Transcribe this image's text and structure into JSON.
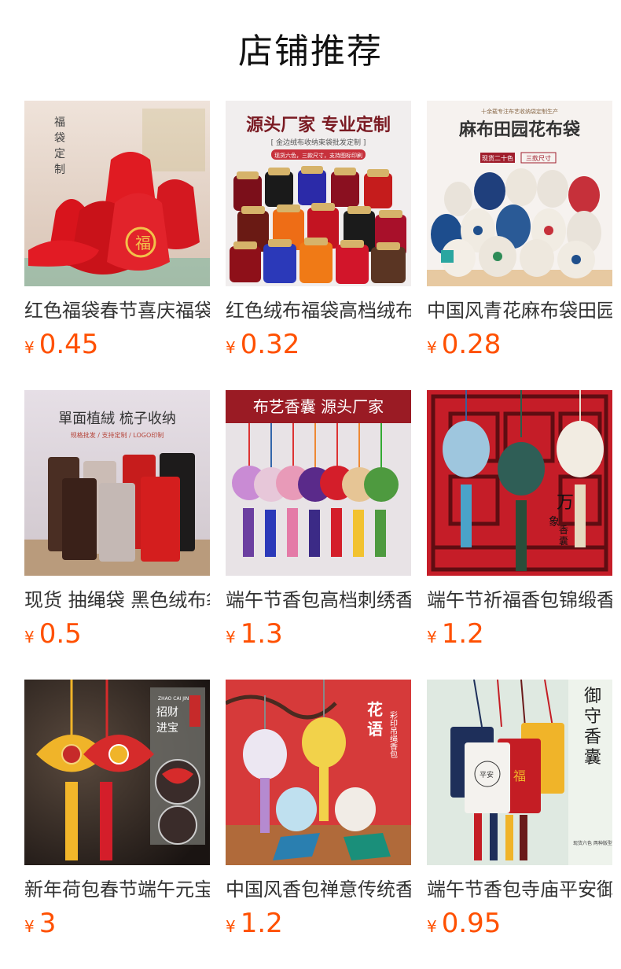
{
  "header": {
    "title": "店铺推荐"
  },
  "currency": "¥",
  "products": [
    {
      "name": "红色福袋春节喜庆福袋",
      "price": "0.45",
      "thumb_texts": [
        "福",
        "袋",
        "定",
        "制",
        "福"
      ],
      "colors": {
        "bg": "#e9d8cc",
        "main": "#d8141c",
        "accent": "#f3c14a"
      }
    },
    {
      "name": "红色绒布福袋高档绒布袋",
      "price": "0.32",
      "thumb_texts": [
        "源头厂家 专业定制",
        "[ 金边绒布收纳束袋批发定制 ]",
        "现货六色，三款尺寸，支持图标印刷"
      ],
      "colors": {
        "bg": "#f1eeee",
        "main": "#9b0f1e",
        "accent": "#d6b36a"
      }
    },
    {
      "name": "中国风青花麻布袋田园风",
      "price": "0.28",
      "thumb_texts": [
        "十余载专注布艺收纳袋定制生产",
        "麻布田园花布袋",
        "现货二十色",
        "三款尺寸"
      ],
      "colors": {
        "bg": "#f6f2ef",
        "main": "#e9e3da",
        "accent": "#1f4f8c"
      }
    },
    {
      "name": "现货 抽绳袋 黑色绒布袋",
      "price": "0.5",
      "thumb_texts": [
        "單面植絨 梳子收纳",
        "规格批发 / 支持定制 / LOGO印制"
      ],
      "colors": {
        "bg": "#d9d2d6",
        "main": "#4a2e23",
        "accent": "#c61c1c"
      }
    },
    {
      "name": "端午节香包高档刺绣香囊",
      "price": "1.3",
      "thumb_texts": [
        "布艺香囊 源头厂家"
      ],
      "colors": {
        "bg": "#e8e3e6",
        "main": "#9a1b24",
        "accent": "#6b3fa0"
      }
    },
    {
      "name": "端午节祈福香包锦缎香囊",
      "price": "1.2",
      "thumb_texts": [
        "万",
        "象",
        "香",
        "囊"
      ],
      "colors": {
        "bg": "#c51d28",
        "main": "#5f0d12",
        "accent": "#4aa3c9"
      }
    },
    {
      "name": "新年荷包春节端午元宝香包",
      "price": "3",
      "thumb_texts": [
        "招财",
        "进宝",
        "ZHAO CAI JIN BAO"
      ],
      "colors": {
        "bg": "#2a2220",
        "main": "#d62b2b",
        "accent": "#f0b429"
      }
    },
    {
      "name": "中国风香包禅意传统香囊",
      "price": "1.2",
      "thumb_texts": [
        "花",
        "语",
        "彩印吊绳香包"
      ],
      "colors": {
        "bg": "#d63a3a",
        "main": "#f2d24a",
        "accent": "#7b55b0"
      }
    },
    {
      "name": "端午节香包寺庙平安御守",
      "price": "0.95",
      "thumb_texts": [
        "御",
        "守",
        "香",
        "囊",
        "平安",
        "福",
        "现货六色 两种版型"
      ],
      "colors": {
        "bg": "#dfe9e1",
        "main": "#1e2f5a",
        "accent": "#c41d24"
      }
    }
  ]
}
